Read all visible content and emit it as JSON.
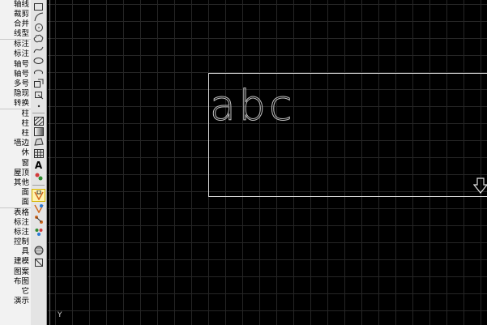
{
  "menu": {
    "items": [
      "轴线",
      "裁剪",
      "合并",
      "线型",
      "标注",
      "标注",
      "轴号",
      "轴号",
      "多号",
      "隐现",
      "转换",
      "柱",
      "柱",
      "柱",
      "墙边",
      "休",
      "窗",
      "屋顶",
      "其他",
      "面",
      "面",
      "表格",
      "标注",
      "标注",
      "控制",
      "具",
      "建模",
      "图案",
      "布图",
      "它",
      "演示"
    ]
  },
  "toolbar": {
    "icons": [
      "rectangle-tool-icon",
      "arc-tool-icon",
      "circle-tool-icon",
      "revcloud-tool-icon",
      "spline-tool-icon",
      "ellipse-tool-icon",
      "ellipse-arc-tool-icon",
      "insert-block-icon",
      "make-block-icon",
      "point-tool-icon",
      "hatch-tool-icon",
      "gradient-tool-icon",
      "region-tool-icon",
      "table-tool-icon",
      "multiline-text-icon",
      "add-selected-icon",
      "object-snap-icon",
      "snap-tracking-icon",
      "snap-settings-icon",
      "select-all-icon",
      "render-icon",
      "3d-orbit-icon"
    ],
    "text_glyph": "A"
  },
  "canvas": {
    "drawing_text": "abc",
    "ucs_label": "Y"
  }
}
